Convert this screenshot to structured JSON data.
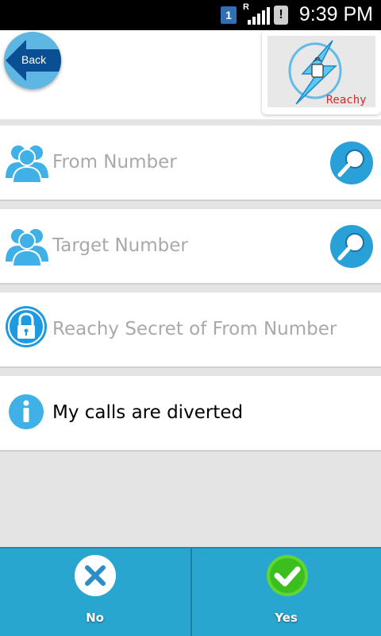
{
  "status_bar": {
    "sim_number": "1",
    "roaming": "R",
    "alert": "!",
    "time": "9:39 PM"
  },
  "header": {
    "back_label": "Back",
    "logo_text": "Reachy"
  },
  "rows": [
    {
      "label": "From Number",
      "icon": "people-icon",
      "action_icon": "search-icon"
    },
    {
      "label": "Target Number",
      "icon": "people-icon",
      "action_icon": "search-icon"
    },
    {
      "label": "Reachy Secret of From Number",
      "icon": "lock-icon"
    },
    {
      "label": "My calls are diverted",
      "icon": "info-icon"
    }
  ],
  "bottom_bar": {
    "no_label": "No",
    "yes_label": "Yes"
  },
  "colors": {
    "accent": "#29a6cf",
    "row_hint": "#a9a9a9",
    "brand_red": "#d3292a"
  }
}
